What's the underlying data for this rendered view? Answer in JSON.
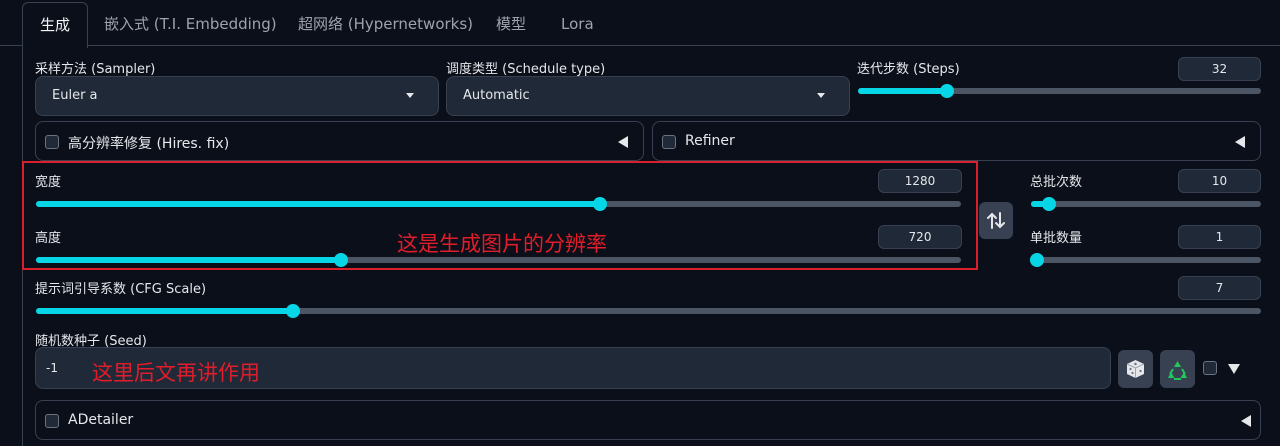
{
  "tabs": [
    "生成",
    "嵌入式 (T.I. Embedding)",
    "超网络 (Hypernetworks)",
    "模型",
    "Lora"
  ],
  "sampler": {
    "label": "采样方法 (Sampler)",
    "value": "Euler a"
  },
  "schedule": {
    "label": "调度类型 (Schedule type)",
    "value": "Automatic"
  },
  "steps": {
    "label": "迭代步数 (Steps)",
    "value": "32",
    "fraction": 0.22
  },
  "hires": {
    "label": "高分辨率修复 (Hires. fix)"
  },
  "refiner": {
    "label": "Refiner"
  },
  "width": {
    "label": "宽度",
    "value": "1280",
    "fraction": 0.61
  },
  "height": {
    "label": "高度",
    "value": "720",
    "fraction": 0.33
  },
  "swap_icon": "swap-arrows-icon",
  "batch_count": {
    "label": "总批次数",
    "value": "10",
    "fraction": 0.08
  },
  "batch_size": {
    "label": "单批数量",
    "value": "1",
    "fraction": 0.0
  },
  "cfg": {
    "label": "提示词引导系数 (CFG Scale)",
    "value": "7",
    "fraction": 0.21
  },
  "seed": {
    "label": "随机数种子 (Seed)",
    "value": "-1"
  },
  "seed_icons": [
    "dice-icon",
    "recycle-icon"
  ],
  "adetailer": {
    "label": "ADetailer"
  },
  "annotations": {
    "resolution": "这是生成图片的分辨率",
    "seed": "这里后文再讲作用"
  },
  "colors": {
    "accent": "#06d6e6",
    "annotation": "#e11d2b",
    "background": "#0b0f19"
  }
}
